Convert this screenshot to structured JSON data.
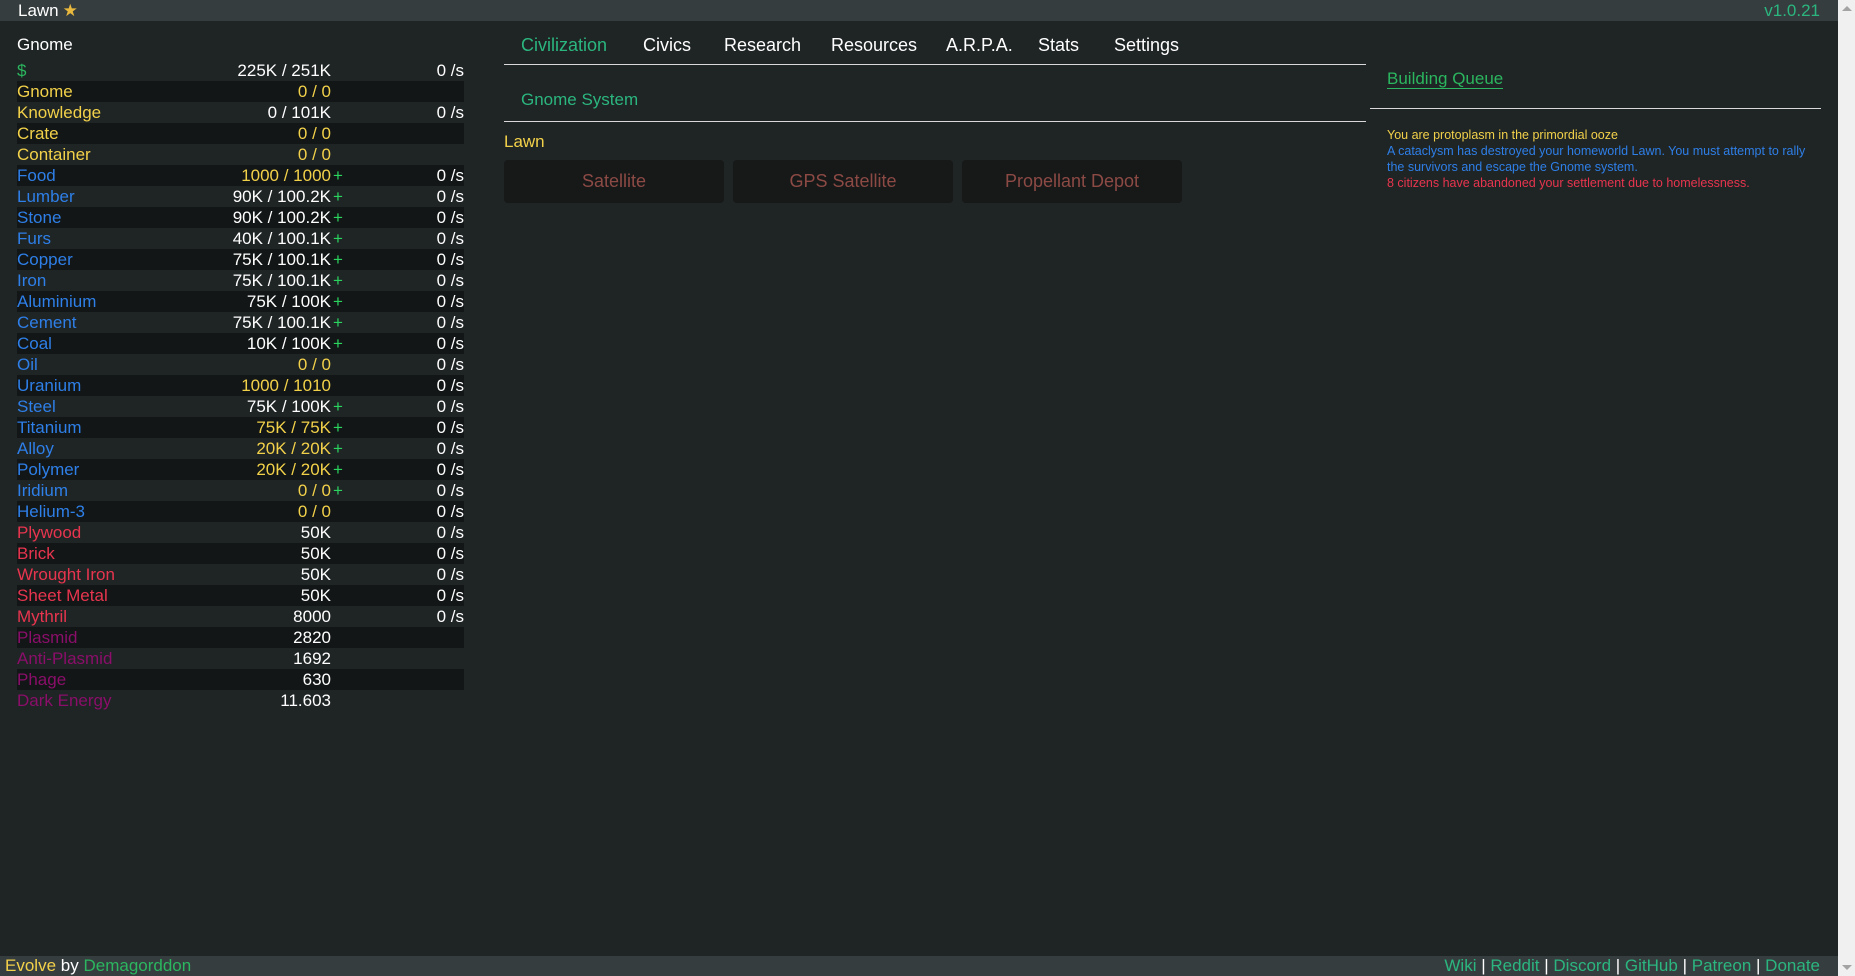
{
  "topbar": {
    "planet": "Lawn",
    "star_icon": "star-icon",
    "version": "v1.0.21"
  },
  "sidebar": {
    "race": "Gnome",
    "resources": [
      {
        "name": "$",
        "color": "green",
        "amount": "225K / 251K",
        "amount_color": "white",
        "plus": false,
        "rate": "0 /s"
      },
      {
        "name": "Gnome",
        "color": "yellow",
        "amount": "0 / 0",
        "amount_color": "yellow",
        "plus": false,
        "rate": ""
      },
      {
        "name": "Knowledge",
        "color": "yellow",
        "amount": "0 / 101K",
        "amount_color": "white",
        "plus": false,
        "rate": "0 /s"
      },
      {
        "name": "Crate",
        "color": "yellow",
        "amount": "0 / 0",
        "amount_color": "yellow",
        "plus": false,
        "rate": ""
      },
      {
        "name": "Container",
        "color": "yellow",
        "amount": "0 / 0",
        "amount_color": "yellow",
        "plus": false,
        "rate": ""
      },
      {
        "name": "Food",
        "color": "blue",
        "amount": "1000 / 1000",
        "amount_color": "yellow",
        "plus": true,
        "rate": "0 /s"
      },
      {
        "name": "Lumber",
        "color": "blue",
        "amount": "90K / 100.2K",
        "amount_color": "white",
        "plus": true,
        "rate": "0 /s"
      },
      {
        "name": "Stone",
        "color": "blue",
        "amount": "90K / 100.2K",
        "amount_color": "white",
        "plus": true,
        "rate": "0 /s"
      },
      {
        "name": "Furs",
        "color": "blue",
        "amount": "40K / 100.1K",
        "amount_color": "white",
        "plus": true,
        "rate": "0 /s"
      },
      {
        "name": "Copper",
        "color": "blue",
        "amount": "75K / 100.1K",
        "amount_color": "white",
        "plus": true,
        "rate": "0 /s"
      },
      {
        "name": "Iron",
        "color": "blue",
        "amount": "75K / 100.1K",
        "amount_color": "white",
        "plus": true,
        "rate": "0 /s"
      },
      {
        "name": "Aluminium",
        "color": "blue",
        "amount": "75K / 100K",
        "amount_color": "white",
        "plus": true,
        "rate": "0 /s"
      },
      {
        "name": "Cement",
        "color": "blue",
        "amount": "75K / 100.1K",
        "amount_color": "white",
        "plus": true,
        "rate": "0 /s"
      },
      {
        "name": "Coal",
        "color": "blue",
        "amount": "10K / 100K",
        "amount_color": "white",
        "plus": true,
        "rate": "0 /s"
      },
      {
        "name": "Oil",
        "color": "blue",
        "amount": "0 / 0",
        "amount_color": "yellow",
        "plus": false,
        "rate": "0 /s"
      },
      {
        "name": "Uranium",
        "color": "blue",
        "amount": "1000 / 1010",
        "amount_color": "yellow",
        "plus": false,
        "rate": "0 /s"
      },
      {
        "name": "Steel",
        "color": "blue",
        "amount": "75K / 100K",
        "amount_color": "white",
        "plus": true,
        "rate": "0 /s"
      },
      {
        "name": "Titanium",
        "color": "blue",
        "amount": "75K / 75K",
        "amount_color": "yellow",
        "plus": true,
        "rate": "0 /s"
      },
      {
        "name": "Alloy",
        "color": "blue",
        "amount": "20K / 20K",
        "amount_color": "yellow",
        "plus": true,
        "rate": "0 /s"
      },
      {
        "name": "Polymer",
        "color": "blue",
        "amount": "20K / 20K",
        "amount_color": "yellow",
        "plus": true,
        "rate": "0 /s"
      },
      {
        "name": "Iridium",
        "color": "blue",
        "amount": "0 / 0",
        "amount_color": "yellow",
        "plus": true,
        "rate": "0 /s"
      },
      {
        "name": "Helium-3",
        "color": "blue",
        "amount": "0 / 0",
        "amount_color": "yellow",
        "plus": false,
        "rate": "0 /s"
      },
      {
        "name": "Plywood",
        "color": "red",
        "amount": "50K",
        "amount_color": "white",
        "plus": false,
        "rate": "0 /s"
      },
      {
        "name": "Brick",
        "color": "red",
        "amount": "50K",
        "amount_color": "white",
        "plus": false,
        "rate": "0 /s"
      },
      {
        "name": "Wrought Iron",
        "color": "red",
        "amount": "50K",
        "amount_color": "white",
        "plus": false,
        "rate": "0 /s"
      },
      {
        "name": "Sheet Metal",
        "color": "red",
        "amount": "50K",
        "amount_color": "white",
        "plus": false,
        "rate": "0 /s"
      },
      {
        "name": "Mythril",
        "color": "red",
        "amount": "8000",
        "amount_color": "white",
        "plus": false,
        "rate": "0 /s"
      },
      {
        "name": "Plasmid",
        "color": "purple",
        "amount": "2820",
        "amount_color": "white",
        "plus": false,
        "rate": ""
      },
      {
        "name": "Anti-Plasmid",
        "color": "purple",
        "amount": "1692",
        "amount_color": "white",
        "plus": false,
        "rate": ""
      },
      {
        "name": "Phage",
        "color": "purple",
        "amount": "630",
        "amount_color": "white",
        "plus": false,
        "rate": ""
      },
      {
        "name": "Dark Energy",
        "color": "purple",
        "amount": "11.603",
        "amount_color": "white",
        "plus": false,
        "rate": ""
      }
    ],
    "plus_label": "+"
  },
  "main": {
    "tabs": [
      {
        "label": "Civilization",
        "active": true
      },
      {
        "label": "Civics",
        "active": false
      },
      {
        "label": "Research",
        "active": false
      },
      {
        "label": "Resources",
        "active": false
      },
      {
        "label": "A.R.P.A.",
        "active": false
      },
      {
        "label": "Stats",
        "active": false
      },
      {
        "label": "Settings",
        "active": false
      }
    ],
    "subtab": "Gnome System",
    "region_title": "Lawn",
    "buildings": [
      "Satellite",
      "GPS Satellite",
      "Propellant Depot"
    ]
  },
  "queue": {
    "title": "Building Queue",
    "messages": [
      {
        "text": "You are protoplasm in the primordial ooze",
        "color": "yellow"
      },
      {
        "text": "A cataclysm has destroyed your homeworld Lawn. You must attempt to rally the survivors and escape the Gnome system.",
        "color": "blue"
      },
      {
        "text": "8 citizens have abandoned your settlement due to homelessness.",
        "color": "red"
      }
    ]
  },
  "footer": {
    "game": "Evolve",
    "by": "by",
    "author": "Demagorddon",
    "links": [
      "Wiki",
      "Reddit",
      "Discord",
      "GitHub",
      "Patreon",
      "Donate"
    ],
    "separator": "|"
  }
}
